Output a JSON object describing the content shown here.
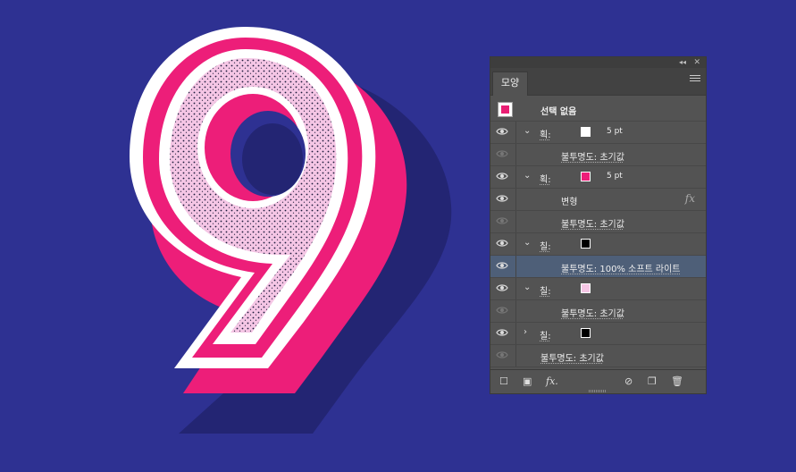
{
  "colors": {
    "background": "#2e3192",
    "magenta": "#ed1e79",
    "pink_fill": "#f5c6e5",
    "shadow": "#222572",
    "white": "#ffffff",
    "black": "#000000"
  },
  "artwork": {
    "glyph": "9"
  },
  "panel": {
    "tab_label": "모양",
    "collapse_icon": "double-chevron-left-icon",
    "close_icon": "close-icon",
    "menu_icon": "menu-icon",
    "header": {
      "label": "선택 없음"
    },
    "rows": [
      {
        "type": "stroke",
        "expanded": true,
        "label": "획:",
        "swatch": "#ffffff",
        "value": "5 pt"
      },
      {
        "type": "opacity",
        "label": "불투명도: 초기값",
        "eye_dim": true
      },
      {
        "type": "stroke",
        "expanded": true,
        "label": "획:",
        "swatch": "#ed1e79",
        "value": "5 pt"
      },
      {
        "type": "effect",
        "label": "변형",
        "fx": "fx"
      },
      {
        "type": "opacity",
        "label": "불투명도: 초기값",
        "eye_dim": true
      },
      {
        "type": "fill",
        "expanded": true,
        "label": "칠:",
        "swatch": "#000000"
      },
      {
        "type": "opacity",
        "label": "불투명도: 100% 소프트 라이트",
        "selected": true
      },
      {
        "type": "fill",
        "expanded": true,
        "label": "칠:",
        "swatch": "#f5c6e5"
      },
      {
        "type": "opacity",
        "label": "불투명도: 초기값",
        "eye_dim": true
      },
      {
        "type": "fill",
        "expanded": false,
        "label": "칠:",
        "swatch": "#000000"
      },
      {
        "type": "opacity-top",
        "label": "불투명도: 초기값",
        "eye_dim": true
      }
    ],
    "bottom_icons": [
      "add-stroke-icon",
      "add-fill-icon",
      "fx-icon",
      "clear-appearance-icon",
      "duplicate-item-icon",
      "delete-icon"
    ],
    "bottom_fx_label": "fx."
  }
}
